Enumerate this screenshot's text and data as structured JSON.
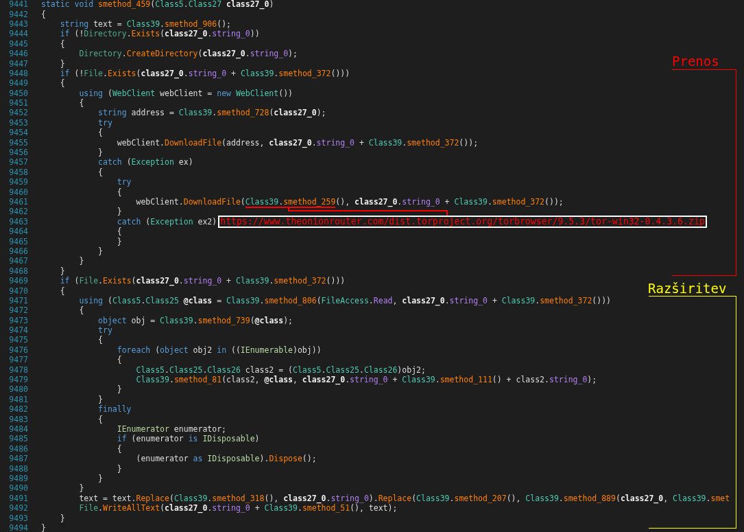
{
  "lines": [
    {
      "number": "9441",
      "tokens": [
        {
          "text": "static void ",
          "kind": "kw"
        },
        {
          "text": "smethod_459",
          "kind": "method"
        },
        {
          "text": "(",
          "kind": "plain"
        },
        {
          "text": "Class5",
          "kind": "type"
        },
        {
          "text": ".",
          "kind": "plain"
        },
        {
          "text": "Class27",
          "kind": "type"
        },
        {
          "text": " class27_0",
          "kind": "param"
        },
        {
          "text": ")",
          "kind": "plain"
        }
      ]
    },
    {
      "number": "9442",
      "tokens": [
        {
          "text": "{",
          "kind": "plain"
        }
      ]
    },
    {
      "number": "9443",
      "tokens": [
        {
          "text": "    string",
          "kind": "kw"
        },
        {
          "text": " text = ",
          "kind": "plain"
        },
        {
          "text": "Class39",
          "kind": "type"
        },
        {
          "text": ".",
          "kind": "plain"
        },
        {
          "text": "smethod_906",
          "kind": "method"
        },
        {
          "text": "();",
          "kind": "plain"
        }
      ]
    },
    {
      "number": "9444",
      "tokens": [
        {
          "text": "    if",
          "kind": "kw"
        },
        {
          "text": " (!",
          "kind": "plain"
        },
        {
          "text": "Directory",
          "kind": "sclass"
        },
        {
          "text": ".",
          "kind": "plain"
        },
        {
          "text": "Exists",
          "kind": "method"
        },
        {
          "text": "(",
          "kind": "plain"
        },
        {
          "text": "class27_0",
          "kind": "param"
        },
        {
          "text": ".",
          "kind": "plain"
        },
        {
          "text": "string_0",
          "kind": "field"
        },
        {
          "text": "))",
          "kind": "plain"
        }
      ]
    },
    {
      "number": "9445",
      "tokens": [
        {
          "text": "    {",
          "kind": "plain"
        }
      ]
    },
    {
      "number": "9446",
      "tokens": [
        {
          "text": "        Directory",
          "kind": "sclass"
        },
        {
          "text": ".",
          "kind": "plain"
        },
        {
          "text": "CreateDirectory",
          "kind": "method"
        },
        {
          "text": "(",
          "kind": "plain"
        },
        {
          "text": "class27_0",
          "kind": "param"
        },
        {
          "text": ".",
          "kind": "plain"
        },
        {
          "text": "string_0",
          "kind": "field"
        },
        {
          "text": ");",
          "kind": "plain"
        }
      ]
    },
    {
      "number": "9447",
      "tokens": [
        {
          "text": "    }",
          "kind": "plain"
        }
      ]
    },
    {
      "number": "9448",
      "tokens": [
        {
          "text": "    if",
          "kind": "kw"
        },
        {
          "text": " (!",
          "kind": "plain"
        },
        {
          "text": "File",
          "kind": "sclass"
        },
        {
          "text": ".",
          "kind": "plain"
        },
        {
          "text": "Exists",
          "kind": "method"
        },
        {
          "text": "(",
          "kind": "plain"
        },
        {
          "text": "class27_0",
          "kind": "param"
        },
        {
          "text": ".",
          "kind": "plain"
        },
        {
          "text": "string_0",
          "kind": "field"
        },
        {
          "text": " + ",
          "kind": "plain"
        },
        {
          "text": "Class39",
          "kind": "type"
        },
        {
          "text": ".",
          "kind": "plain"
        },
        {
          "text": "smethod_372",
          "kind": "method"
        },
        {
          "text": "()))",
          "kind": "plain"
        }
      ]
    },
    {
      "number": "9449",
      "tokens": [
        {
          "text": "    {",
          "kind": "plain"
        }
      ]
    },
    {
      "number": "9450",
      "tokens": [
        {
          "text": "        using",
          "kind": "kw"
        },
        {
          "text": " (",
          "kind": "plain"
        },
        {
          "text": "WebClient",
          "kind": "type"
        },
        {
          "text": " webClient = ",
          "kind": "plain"
        },
        {
          "text": "new ",
          "kind": "kw"
        },
        {
          "text": "WebClient",
          "kind": "type"
        },
        {
          "text": "())",
          "kind": "plain"
        }
      ]
    },
    {
      "number": "9451",
      "tokens": [
        {
          "text": "        {",
          "kind": "plain"
        }
      ]
    },
    {
      "number": "9452",
      "tokens": [
        {
          "text": "            string",
          "kind": "kw"
        },
        {
          "text": " address = ",
          "kind": "plain"
        },
        {
          "text": "Class39",
          "kind": "type"
        },
        {
          "text": ".",
          "kind": "plain"
        },
        {
          "text": "smethod_728",
          "kind": "method"
        },
        {
          "text": "(",
          "kind": "plain"
        },
        {
          "text": "class27_0",
          "kind": "param"
        },
        {
          "text": ");",
          "kind": "plain"
        }
      ]
    },
    {
      "number": "9453",
      "tokens": [
        {
          "text": "            try",
          "kind": "kw"
        }
      ]
    },
    {
      "number": "9454",
      "tokens": [
        {
          "text": "            {",
          "kind": "plain"
        }
      ]
    },
    {
      "number": "9455",
      "tokens": [
        {
          "text": "                webClient.",
          "kind": "plain"
        },
        {
          "text": "DownloadFile",
          "kind": "method"
        },
        {
          "text": "(address, ",
          "kind": "plain"
        },
        {
          "text": "class27_0",
          "kind": "param"
        },
        {
          "text": ".",
          "kind": "plain"
        },
        {
          "text": "string_0",
          "kind": "field"
        },
        {
          "text": " + ",
          "kind": "plain"
        },
        {
          "text": "Class39",
          "kind": "type"
        },
        {
          "text": ".",
          "kind": "plain"
        },
        {
          "text": "smethod_372",
          "kind": "method"
        },
        {
          "text": "());",
          "kind": "plain"
        }
      ]
    },
    {
      "number": "9456",
      "tokens": [
        {
          "text": "            }",
          "kind": "plain"
        }
      ]
    },
    {
      "number": "9457",
      "tokens": [
        {
          "text": "            catch",
          "kind": "kw"
        },
        {
          "text": " (",
          "kind": "plain"
        },
        {
          "text": "Exception",
          "kind": "type"
        },
        {
          "text": " ex)",
          "kind": "plain"
        }
      ]
    },
    {
      "number": "9458",
      "tokens": [
        {
          "text": "            {",
          "kind": "plain"
        }
      ]
    },
    {
      "number": "9459",
      "tokens": [
        {
          "text": "                try",
          "kind": "kw"
        }
      ]
    },
    {
      "number": "9460",
      "tokens": [
        {
          "text": "                {",
          "kind": "plain"
        }
      ]
    },
    {
      "number": "9461",
      "tokens": [
        {
          "text": "                    webClient.",
          "kind": "plain"
        },
        {
          "text": "DownloadFile",
          "kind": "method"
        },
        {
          "text": "(",
          "kind": "plain"
        },
        {
          "text": "Class39",
          "kind": "type",
          "marked": true
        },
        {
          "text": ".",
          "kind": "plain",
          "marked": true
        },
        {
          "text": "smethod_259",
          "kind": "method",
          "marked": true
        },
        {
          "text": "(), ",
          "kind": "plain"
        },
        {
          "text": "class27_0",
          "kind": "param"
        },
        {
          "text": ".",
          "kind": "plain"
        },
        {
          "text": "string_0",
          "kind": "field"
        },
        {
          "text": " + ",
          "kind": "plain"
        },
        {
          "text": "Class39",
          "kind": "type"
        },
        {
          "text": ".",
          "kind": "plain"
        },
        {
          "text": "smethod_372",
          "kind": "method"
        },
        {
          "text": "());",
          "kind": "plain"
        }
      ]
    },
    {
      "number": "9462",
      "tokens": [
        {
          "text": "                }",
          "kind": "plain"
        }
      ]
    },
    {
      "number": "9463",
      "tokens": [
        {
          "text": "                catch",
          "kind": "kw"
        },
        {
          "text": " (",
          "kind": "plain"
        },
        {
          "text": "Exception",
          "kind": "type"
        },
        {
          "text": " ex2)",
          "kind": "plain"
        }
      ],
      "callout": "https://www.theonionrouter.com/dist.torproject.org/torbrowser/9.5.3/tor-win32-0.4.3.6.zip"
    },
    {
      "number": "9464",
      "tokens": [
        {
          "text": "                {",
          "kind": "plain"
        }
      ]
    },
    {
      "number": "9465",
      "tokens": [
        {
          "text": "                }",
          "kind": "plain"
        }
      ]
    },
    {
      "number": "9466",
      "tokens": [
        {
          "text": "            }",
          "kind": "plain"
        }
      ]
    },
    {
      "number": "9467",
      "tokens": [
        {
          "text": "        }",
          "kind": "plain"
        }
      ]
    },
    {
      "number": "9468",
      "tokens": [
        {
          "text": "    }",
          "kind": "plain"
        }
      ]
    },
    {
      "number": "9469",
      "tokens": [
        {
          "text": "    if",
          "kind": "kw"
        },
        {
          "text": " (",
          "kind": "plain"
        },
        {
          "text": "File",
          "kind": "sclass"
        },
        {
          "text": ".",
          "kind": "plain"
        },
        {
          "text": "Exists",
          "kind": "method"
        },
        {
          "text": "(",
          "kind": "plain"
        },
        {
          "text": "class27_0",
          "kind": "param"
        },
        {
          "text": ".",
          "kind": "plain"
        },
        {
          "text": "string_0",
          "kind": "field"
        },
        {
          "text": " + ",
          "kind": "plain"
        },
        {
          "text": "Class39",
          "kind": "type"
        },
        {
          "text": ".",
          "kind": "plain"
        },
        {
          "text": "smethod_372",
          "kind": "method"
        },
        {
          "text": "()))",
          "kind": "plain"
        }
      ]
    },
    {
      "number": "9470",
      "tokens": [
        {
          "text": "    {",
          "kind": "plain"
        }
      ]
    },
    {
      "number": "9471",
      "tokens": [
        {
          "text": "        using",
          "kind": "kw"
        },
        {
          "text": " (",
          "kind": "plain"
        },
        {
          "text": "Class5",
          "kind": "type"
        },
        {
          "text": ".",
          "kind": "plain"
        },
        {
          "text": "Class25",
          "kind": "type"
        },
        {
          "text": " @class",
          "kind": "param"
        },
        {
          "text": " = ",
          "kind": "plain"
        },
        {
          "text": "Class39",
          "kind": "type"
        },
        {
          "text": ".",
          "kind": "plain"
        },
        {
          "text": "smethod_806",
          "kind": "method"
        },
        {
          "text": "(",
          "kind": "plain"
        },
        {
          "text": "FileAccess",
          "kind": "type"
        },
        {
          "text": ".",
          "kind": "plain"
        },
        {
          "text": "Read",
          "kind": "field"
        },
        {
          "text": ", ",
          "kind": "plain"
        },
        {
          "text": "class27_0",
          "kind": "param"
        },
        {
          "text": ".",
          "kind": "plain"
        },
        {
          "text": "string_0",
          "kind": "field"
        },
        {
          "text": " + ",
          "kind": "plain"
        },
        {
          "text": "Class39",
          "kind": "type"
        },
        {
          "text": ".",
          "kind": "plain"
        },
        {
          "text": "smethod_372",
          "kind": "method"
        },
        {
          "text": "()))",
          "kind": "plain"
        }
      ]
    },
    {
      "number": "9472",
      "tokens": [
        {
          "text": "        {",
          "kind": "plain"
        }
      ]
    },
    {
      "number": "9473",
      "tokens": [
        {
          "text": "            object",
          "kind": "kw"
        },
        {
          "text": " obj = ",
          "kind": "plain"
        },
        {
          "text": "Class39",
          "kind": "type"
        },
        {
          "text": ".",
          "kind": "plain"
        },
        {
          "text": "smethod_739",
          "kind": "method"
        },
        {
          "text": "(",
          "kind": "plain"
        },
        {
          "text": "@class",
          "kind": "param"
        },
        {
          "text": ");",
          "kind": "plain"
        }
      ]
    },
    {
      "number": "9474",
      "tokens": [
        {
          "text": "            try",
          "kind": "kw"
        }
      ]
    },
    {
      "number": "9475",
      "tokens": [
        {
          "text": "            {",
          "kind": "plain"
        }
      ]
    },
    {
      "number": "9476",
      "tokens": [
        {
          "text": "                foreach",
          "kind": "kw"
        },
        {
          "text": " (",
          "kind": "plain"
        },
        {
          "text": "object",
          "kind": "kw"
        },
        {
          "text": " obj2 ",
          "kind": "plain"
        },
        {
          "text": "in",
          "kind": "kw"
        },
        {
          "text": " ((",
          "kind": "plain"
        },
        {
          "text": "IEnumerable",
          "kind": "iface"
        },
        {
          "text": ")obj))",
          "kind": "plain"
        }
      ]
    },
    {
      "number": "9477",
      "tokens": [
        {
          "text": "                {",
          "kind": "plain"
        }
      ]
    },
    {
      "number": "9478",
      "tokens": [
        {
          "text": "                    Class5",
          "kind": "type"
        },
        {
          "text": ".",
          "kind": "plain"
        },
        {
          "text": "Class25",
          "kind": "type"
        },
        {
          "text": ".",
          "kind": "plain"
        },
        {
          "text": "Class26",
          "kind": "type"
        },
        {
          "text": " class2 = (",
          "kind": "plain"
        },
        {
          "text": "Class5",
          "kind": "type"
        },
        {
          "text": ".",
          "kind": "plain"
        },
        {
          "text": "Class25",
          "kind": "type"
        },
        {
          "text": ".",
          "kind": "plain"
        },
        {
          "text": "Class26",
          "kind": "type"
        },
        {
          "text": ")obj2;",
          "kind": "plain"
        }
      ]
    },
    {
      "number": "9479",
      "tokens": [
        {
          "text": "                    Class39",
          "kind": "type"
        },
        {
          "text": ".",
          "kind": "plain"
        },
        {
          "text": "smethod_81",
          "kind": "method"
        },
        {
          "text": "(class2, ",
          "kind": "plain"
        },
        {
          "text": "@class",
          "kind": "param"
        },
        {
          "text": ", ",
          "kind": "plain"
        },
        {
          "text": "class27_0",
          "kind": "param"
        },
        {
          "text": ".",
          "kind": "plain"
        },
        {
          "text": "string_0",
          "kind": "field"
        },
        {
          "text": " + ",
          "kind": "plain"
        },
        {
          "text": "Class39",
          "kind": "type"
        },
        {
          "text": ".",
          "kind": "plain"
        },
        {
          "text": "smethod_111",
          "kind": "method"
        },
        {
          "text": "() + class2.",
          "kind": "plain"
        },
        {
          "text": "string_0",
          "kind": "field"
        },
        {
          "text": ");",
          "kind": "plain"
        }
      ]
    },
    {
      "number": "9480",
      "tokens": [
        {
          "text": "                }",
          "kind": "plain"
        }
      ]
    },
    {
      "number": "9481",
      "tokens": [
        {
          "text": "            }",
          "kind": "plain"
        }
      ]
    },
    {
      "number": "9482",
      "tokens": [
        {
          "text": "            finally",
          "kind": "kw"
        }
      ]
    },
    {
      "number": "9483",
      "tokens": [
        {
          "text": "            {",
          "kind": "plain"
        }
      ]
    },
    {
      "number": "9484",
      "tokens": [
        {
          "text": "                IEnumerator",
          "kind": "iface"
        },
        {
          "text": " enumerator;",
          "kind": "plain"
        }
      ]
    },
    {
      "number": "9485",
      "tokens": [
        {
          "text": "                if",
          "kind": "kw"
        },
        {
          "text": " (enumerator ",
          "kind": "plain"
        },
        {
          "text": "is ",
          "kind": "kw"
        },
        {
          "text": "IDisposable",
          "kind": "iface"
        },
        {
          "text": ")",
          "kind": "plain"
        }
      ]
    },
    {
      "number": "9486",
      "tokens": [
        {
          "text": "                {",
          "kind": "plain"
        }
      ]
    },
    {
      "number": "9487",
      "tokens": [
        {
          "text": "                    (enumerator ",
          "kind": "plain"
        },
        {
          "text": "as ",
          "kind": "kw"
        },
        {
          "text": "IDisposable",
          "kind": "iface"
        },
        {
          "text": ").",
          "kind": "plain"
        },
        {
          "text": "Dispose",
          "kind": "method"
        },
        {
          "text": "();",
          "kind": "plain"
        }
      ]
    },
    {
      "number": "9488",
      "tokens": [
        {
          "text": "                }",
          "kind": "plain"
        }
      ]
    },
    {
      "number": "9489",
      "tokens": [
        {
          "text": "            }",
          "kind": "plain"
        }
      ]
    },
    {
      "number": "9490",
      "tokens": [
        {
          "text": "        }",
          "kind": "plain"
        }
      ]
    },
    {
      "number": "9491",
      "tokens": [
        {
          "text": "        text = text.",
          "kind": "plain"
        },
        {
          "text": "Replace",
          "kind": "method"
        },
        {
          "text": "(",
          "kind": "plain"
        },
        {
          "text": "Class39",
          "kind": "type"
        },
        {
          "text": ".",
          "kind": "plain"
        },
        {
          "text": "smethod_318",
          "kind": "method"
        },
        {
          "text": "(), ",
          "kind": "plain"
        },
        {
          "text": "class27_0",
          "kind": "param"
        },
        {
          "text": ".",
          "kind": "plain"
        },
        {
          "text": "string_0",
          "kind": "field"
        },
        {
          "text": ").",
          "kind": "plain"
        },
        {
          "text": "Replace",
          "kind": "method"
        },
        {
          "text": "(",
          "kind": "plain"
        },
        {
          "text": "Class39",
          "kind": "type"
        },
        {
          "text": ".",
          "kind": "plain"
        },
        {
          "text": "smethod_207",
          "kind": "method"
        },
        {
          "text": "(), ",
          "kind": "plain"
        },
        {
          "text": "Class39",
          "kind": "type"
        },
        {
          "text": ".",
          "kind": "plain"
        },
        {
          "text": "smethod_889",
          "kind": "method"
        },
        {
          "text": "(",
          "kind": "plain"
        },
        {
          "text": "class27_0",
          "kind": "param"
        },
        {
          "text": ", ",
          "kind": "plain"
        },
        {
          "text": "Class39",
          "kind": "type"
        },
        {
          "text": ".",
          "kind": "plain"
        },
        {
          "text": "smet",
          "kind": "method"
        }
      ]
    },
    {
      "number": "9492",
      "tokens": [
        {
          "text": "        File",
          "kind": "sclass"
        },
        {
          "text": ".",
          "kind": "plain"
        },
        {
          "text": "WriteAllText",
          "kind": "method"
        },
        {
          "text": "(",
          "kind": "plain"
        },
        {
          "text": "class27_0",
          "kind": "param"
        },
        {
          "text": ".",
          "kind": "plain"
        },
        {
          "text": "string_0",
          "kind": "field"
        },
        {
          "text": " + ",
          "kind": "plain"
        },
        {
          "text": "Class39",
          "kind": "type"
        },
        {
          "text": ".",
          "kind": "plain"
        },
        {
          "text": "smethod_51",
          "kind": "method"
        },
        {
          "text": "(), text);",
          "kind": "plain"
        }
      ]
    },
    {
      "number": "9493",
      "tokens": [
        {
          "text": "    }",
          "kind": "plain"
        }
      ]
    },
    {
      "number": "9494",
      "tokens": [
        {
          "text": "}",
          "kind": "plain"
        }
      ]
    }
  ],
  "annotations": [
    {
      "label": "Prenos",
      "color": "#ff0000"
    },
    {
      "label": "Razširitev",
      "color": "#ffff00"
    }
  ]
}
